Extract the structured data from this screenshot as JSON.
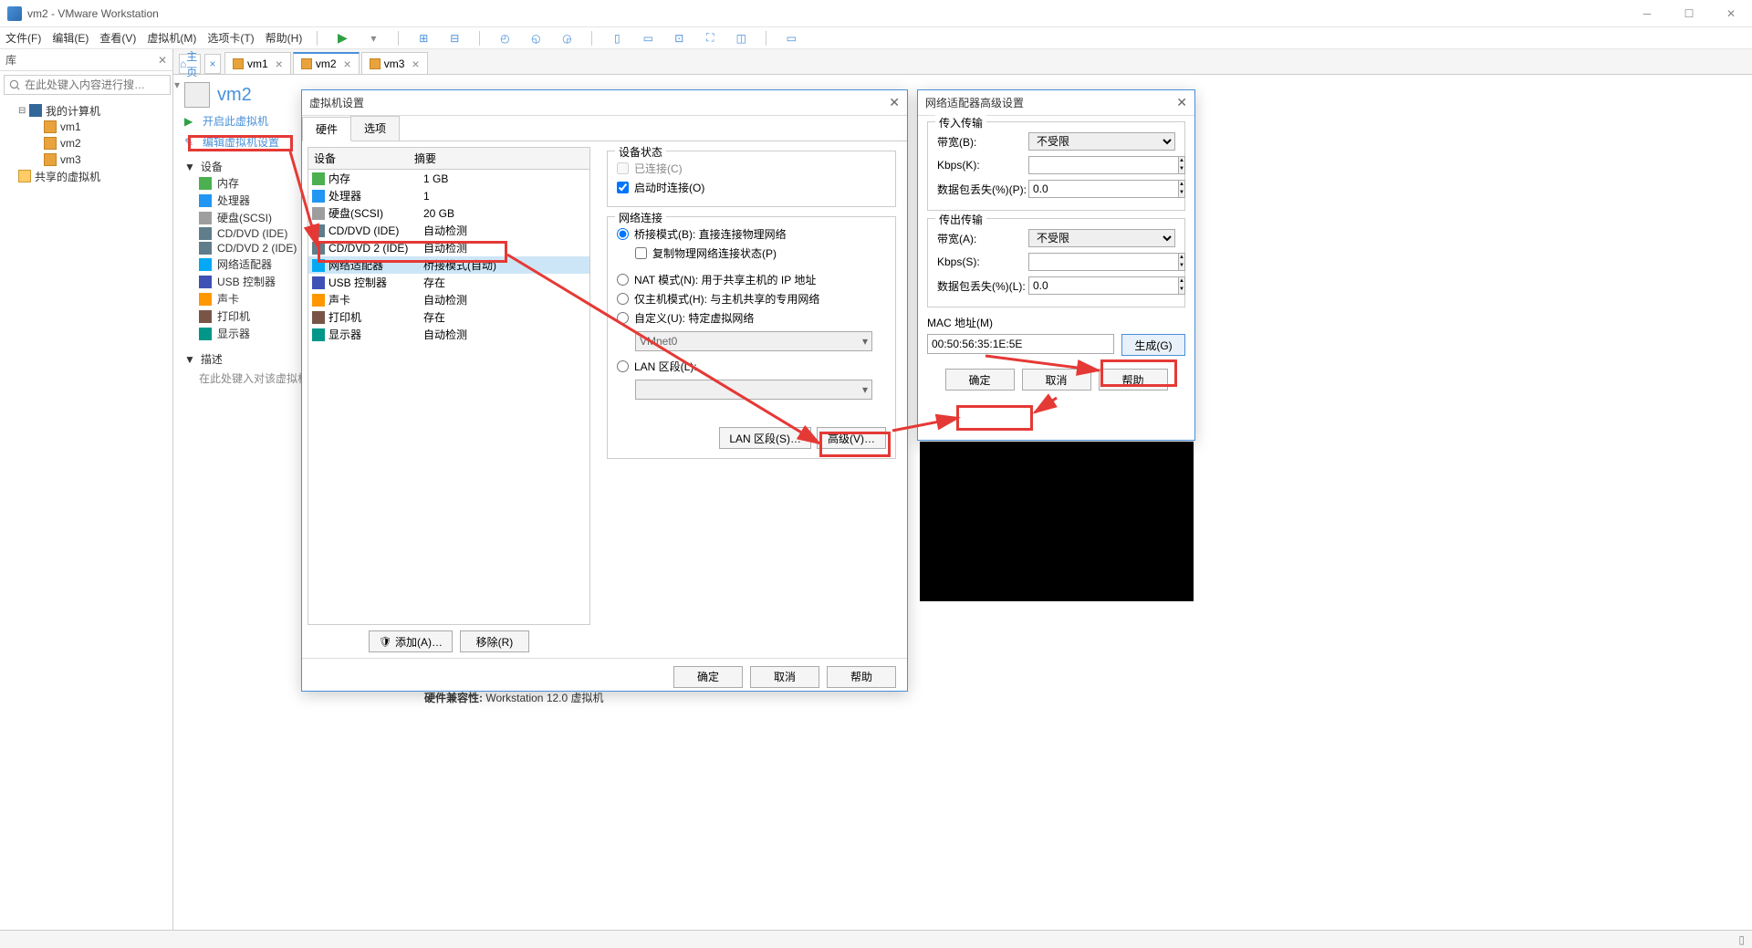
{
  "window": {
    "title": "vm2 - VMware Workstation"
  },
  "menu": {
    "file": "文件(F)",
    "edit": "编辑(E)",
    "view": "查看(V)",
    "vm": "虚拟机(M)",
    "tabs": "选项卡(T)",
    "help": "帮助(H)"
  },
  "library": {
    "title": "库",
    "search_placeholder": "在此处键入内容进行搜…",
    "root": "我的计算机",
    "vms": [
      "vm1",
      "vm2",
      "vm3"
    ],
    "shared": "共享的虚拟机"
  },
  "tabs": {
    "home": "主页",
    "items": [
      {
        "label": "vm1"
      },
      {
        "label": "vm2"
      },
      {
        "label": "vm3"
      }
    ],
    "active_index": 1
  },
  "vm_panel": {
    "vm_name": "vm2",
    "power_on": "开启此虚拟机",
    "edit_settings": "编辑虚拟机设置",
    "devices_head": "设备",
    "devices": [
      {
        "name": "内存"
      },
      {
        "name": "处理器"
      },
      {
        "name": "硬盘(SCSI)"
      },
      {
        "name": "CD/DVD (IDE)"
      },
      {
        "name": "CD/DVD 2 (IDE)"
      },
      {
        "name": "网络适配器"
      },
      {
        "name": "USB 控制器"
      },
      {
        "name": "声卡"
      },
      {
        "name": "打印机"
      },
      {
        "name": "显示器"
      }
    ],
    "desc_head": "描述",
    "desc_hint": "在此处键入对该虚拟机…"
  },
  "vm_settings_dialog": {
    "title": "虚拟机设置",
    "tab_hw": "硬件",
    "tab_opt": "选项",
    "col_dev": "设备",
    "col_sum": "摘要",
    "rows": [
      {
        "dev": "内存",
        "sum": "1 GB",
        "ic": "ic-mem"
      },
      {
        "dev": "处理器",
        "sum": "1",
        "ic": "ic-cpu"
      },
      {
        "dev": "硬盘(SCSI)",
        "sum": "20 GB",
        "ic": "ic-disk"
      },
      {
        "dev": "CD/DVD (IDE)",
        "sum": "自动检测",
        "ic": "ic-cd"
      },
      {
        "dev": "CD/DVD 2 (IDE)",
        "sum": "自动检测",
        "ic": "ic-cd"
      },
      {
        "dev": "网络适配器",
        "sum": "桥接模式(自动)",
        "ic": "ic-net"
      },
      {
        "dev": "USB 控制器",
        "sum": "存在",
        "ic": "ic-usb"
      },
      {
        "dev": "声卡",
        "sum": "自动检测",
        "ic": "ic-snd"
      },
      {
        "dev": "打印机",
        "sum": "存在",
        "ic": "ic-prn"
      },
      {
        "dev": "显示器",
        "sum": "自动检测",
        "ic": "ic-mon"
      }
    ],
    "selected_index": 5,
    "dev_state": {
      "title": "设备状态",
      "connected": "已连接(C)",
      "connect_on_power": "启动时连接(O)"
    },
    "net_conn": {
      "title": "网络连接",
      "bridged": "桥接模式(B): 直接连接物理网络",
      "replicate": "复制物理网络连接状态(P)",
      "nat": "NAT 模式(N): 用于共享主机的 IP 地址",
      "hostonly": "仅主机模式(H): 与主机共享的专用网络",
      "custom": "自定义(U): 特定虚拟网络",
      "vmnet": "VMnet0",
      "lan": "LAN 区段(L):"
    },
    "btn_lan": "LAN 区段(S)…",
    "btn_adv": "高级(V)…",
    "btn_add": "添加(A)…",
    "btn_remove": "移除(R)",
    "btn_ok": "确定",
    "btn_cancel": "取消",
    "btn_help": "帮助"
  },
  "adv_dialog": {
    "title": "网络适配器高级设置",
    "incoming": {
      "title": "传入传输",
      "bandwidth": "带宽(B):",
      "bandwidth_val": "不受限",
      "kbps": "Kbps(K):",
      "kbps_val": "",
      "loss": "数据包丢失(%)(P):",
      "loss_val": "0.0"
    },
    "outgoing": {
      "title": "传出传输",
      "bandwidth": "带宽(A):",
      "bandwidth_val": "不受限",
      "kbps": "Kbps(S):",
      "kbps_val": "",
      "loss": "数据包丢失(%)(L):",
      "loss_val": "0.0"
    },
    "mac": {
      "label": "MAC 地址(M)",
      "value": "00:50:56:35:1E:5E",
      "gen": "生成(G)"
    },
    "btn_ok": "确定",
    "btn_cancel": "取消",
    "btn_help": "帮助"
  },
  "hw_compat": {
    "label": "硬件兼容性:",
    "value": "Workstation 12.0 虚拟机"
  }
}
